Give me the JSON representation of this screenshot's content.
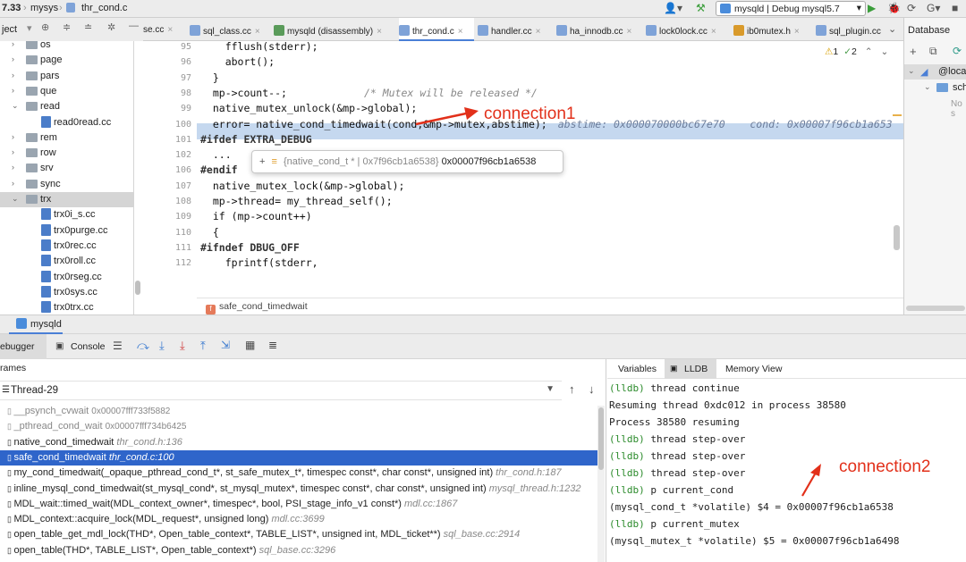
{
  "topbar": {
    "version": "7.33",
    "crumb1": "mysys",
    "crumb2": "thr_cond.c",
    "run_config": "mysqld | Debug mysql5.7",
    "user_icon": "user-icon",
    "build_icon": "hammer-icon"
  },
  "project_header": "ject",
  "tabs": [
    {
      "label": "se.cc"
    },
    {
      "label": "sql_class.cc"
    },
    {
      "label": "mysqld (disassembly)"
    },
    {
      "label": "thr_cond.c"
    },
    {
      "label": "handler.cc"
    },
    {
      "label": "ha_innodb.cc"
    },
    {
      "label": "lock0lock.cc"
    },
    {
      "label": "ib0mutex.h"
    },
    {
      "label": "sql_plugin.cc"
    }
  ],
  "database_panel": {
    "title": "Database",
    "root": "@loca",
    "schema": "sch",
    "note": "No s"
  },
  "tree": [
    {
      "label": "os"
    },
    {
      "label": "page"
    },
    {
      "label": "pars"
    },
    {
      "label": "que"
    },
    {
      "label": "read"
    },
    {
      "label": "read0read.cc"
    },
    {
      "label": "rem"
    },
    {
      "label": "row"
    },
    {
      "label": "srv"
    },
    {
      "label": "sync"
    },
    {
      "label": "trx"
    },
    {
      "label": "trx0i_s.cc"
    },
    {
      "label": "trx0purge.cc"
    },
    {
      "label": "trx0rec.cc"
    },
    {
      "label": "trx0roll.cc"
    },
    {
      "label": "trx0rseg.cc"
    },
    {
      "label": "trx0sys.cc"
    },
    {
      "label": "trx0trx.cc"
    }
  ],
  "code": {
    "line_numbers": [
      "95",
      "96",
      "97",
      "98",
      "99",
      "100",
      "101",
      "102",
      "106",
      "107",
      "108",
      "109",
      "110",
      "111",
      "112"
    ],
    "lines": [
      "    fflush(stderr);",
      "    abort();",
      "  }",
      "  mp->count--;",
      "  native_mutex_unlock(&mp->global);",
      "  error= native_cond_timedwait(cond,&mp->mutex,abstime);",
      "#ifdef EXTRA_DEBUG",
      "  ...",
      "#endif",
      "  native_mutex_lock(&mp->global);",
      "  mp->thread= my_thread_self();",
      "  if (mp->count++)",
      "  {",
      "#ifndef DBUG_OFF",
      "    fprintf(stderr,"
    ],
    "comment_98": "/* Mutex will be released */",
    "inline_values": "abstime: 0x000070000bc67e70    cond: 0x00007f96cb1a653",
    "warnings": "1",
    "weak_warnings": "2",
    "breadcrumb": "safe_cond_timedwait"
  },
  "tooltip": {
    "type": "{native_cond_t * | 0x7f96cb1a6538}",
    "value": "0x00007f96cb1a6538"
  },
  "annotations": {
    "connection1": "connection1",
    "connection2": "connection2"
  },
  "run_panel": {
    "title": "mysqld",
    "debugger_tab": "ebugger",
    "console_tab": "Console"
  },
  "frames": {
    "header": "rames",
    "thread": "Thread-29",
    "rows": [
      {
        "fn": "__psynch_cvwait",
        "loc": "0x00007fff733f5882",
        "dim": true
      },
      {
        "fn": "_pthread_cond_wait",
        "loc": "0x00007fff734b6425",
        "dim": true
      },
      {
        "fn": "native_cond_timedwait",
        "loc": "thr_cond.h:136",
        "dim": false
      },
      {
        "fn": "safe_cond_timedwait",
        "loc": "thr_cond.c:100",
        "dim": false,
        "selected": true
      },
      {
        "fn": "my_cond_timedwait(_opaque_pthread_cond_t*, st_safe_mutex_t*, timespec const*, char const*, unsigned int)",
        "loc": "thr_cond.h:187",
        "dim": false
      },
      {
        "fn": "inline_mysql_cond_timedwait(st_mysql_cond*, st_mysql_mutex*, timespec const*, char const*, unsigned int)",
        "loc": "mysql_thread.h:1232",
        "dim": false
      },
      {
        "fn": "MDL_wait::timed_wait(MDL_context_owner*, timespec*, bool, PSI_stage_info_v1 const*)",
        "loc": "mdl.cc:1867",
        "dim": false
      },
      {
        "fn": "MDL_context::acquire_lock(MDL_request*, unsigned long)",
        "loc": "mdl.cc:3699",
        "dim": false
      },
      {
        "fn": "open_table_get_mdl_lock(THD*, Open_table_context*, TABLE_LIST*, unsigned int, MDL_ticket**)",
        "loc": "sql_base.cc:2914",
        "dim": false
      },
      {
        "fn": "open_table(THD*, TABLE_LIST*, Open_table_context*)",
        "loc": "sql_base.cc:3296",
        "dim": false
      }
    ]
  },
  "lldb": {
    "tabs": [
      "Variables",
      "LLDB",
      "Memory View"
    ],
    "lines": [
      {
        "prompt": "(lldb) ",
        "text": "thread continue"
      },
      {
        "prompt": "",
        "text": "Resuming thread 0xdc012 in process 38580"
      },
      {
        "prompt": "",
        "text": "Process 38580 resuming"
      },
      {
        "prompt": "(lldb) ",
        "text": "thread step-over"
      },
      {
        "prompt": "(lldb) ",
        "text": "thread step-over"
      },
      {
        "prompt": "(lldb) ",
        "text": "thread step-over"
      },
      {
        "prompt": "(lldb) ",
        "text": "p current_cond"
      },
      {
        "prompt": "",
        "text": "(mysql_cond_t *volatile) $4 = 0x00007f96cb1a6538"
      },
      {
        "prompt": "(lldb) ",
        "text": "p current_mutex"
      },
      {
        "prompt": "",
        "text": "(mysql_mutex_t *volatile) $5 = 0x00007f96cb1a6498"
      }
    ]
  }
}
